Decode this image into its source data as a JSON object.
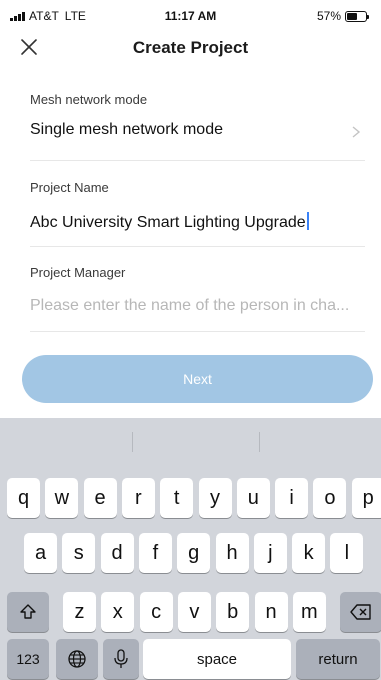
{
  "status_bar": {
    "carrier": "AT&T",
    "network": "LTE",
    "time": "11:17 AM",
    "battery_percent": "57%",
    "battery_level": 0.57
  },
  "header": {
    "title": "Create Project",
    "close_icon": "close-icon"
  },
  "form": {
    "mesh_mode": {
      "label": "Mesh network mode",
      "value": "Single mesh network mode",
      "icon": "chevron-right-icon"
    },
    "project_name": {
      "label": "Project Name",
      "value": "Abc University Smart Lighting Upgrade"
    },
    "project_manager": {
      "label": "Project Manager",
      "placeholder": "Please enter the name of the person in cha..."
    }
  },
  "next_button": {
    "label": "Next"
  },
  "keyboard": {
    "row1": [
      "q",
      "w",
      "e",
      "r",
      "t",
      "y",
      "u",
      "i",
      "o",
      "p"
    ],
    "row2": [
      "a",
      "s",
      "d",
      "f",
      "g",
      "h",
      "j",
      "k",
      "l"
    ],
    "row3": [
      "z",
      "x",
      "c",
      "v",
      "b",
      "n",
      "m"
    ],
    "shift_icon": "shift-icon",
    "backspace_icon": "backspace-icon",
    "numbers_label": "123",
    "globe_icon": "globe-icon",
    "mic_icon": "microphone-icon",
    "space_label": "space",
    "return_label": "return"
  },
  "colors": {
    "button_bg": "#a2c6e4",
    "keyboard_bg": "#d2d5db",
    "cursor": "#3a82f7"
  }
}
